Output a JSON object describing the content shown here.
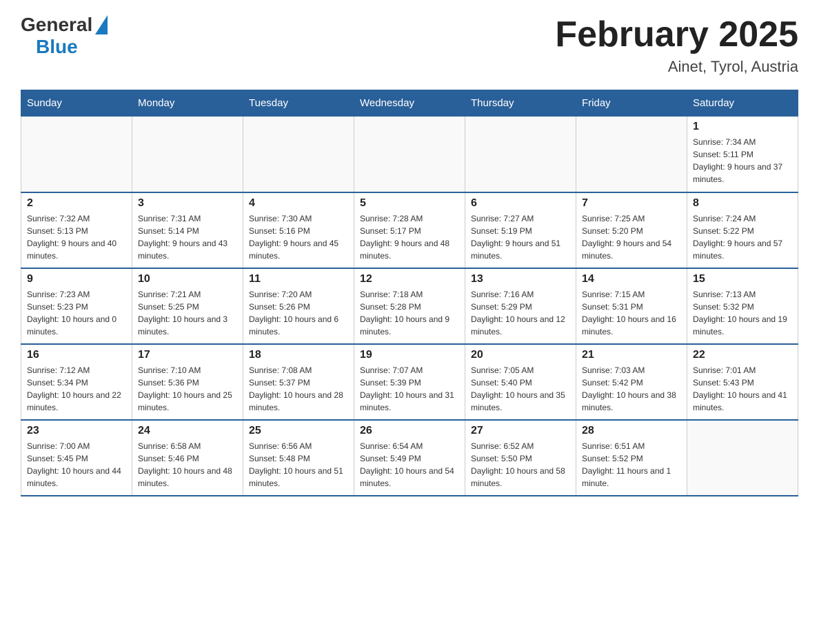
{
  "logo": {
    "general": "General",
    "blue": "Blue"
  },
  "title": "February 2025",
  "subtitle": "Ainet, Tyrol, Austria",
  "days_of_week": [
    "Sunday",
    "Monday",
    "Tuesday",
    "Wednesday",
    "Thursday",
    "Friday",
    "Saturday"
  ],
  "weeks": [
    [
      {
        "day": "",
        "info": ""
      },
      {
        "day": "",
        "info": ""
      },
      {
        "day": "",
        "info": ""
      },
      {
        "day": "",
        "info": ""
      },
      {
        "day": "",
        "info": ""
      },
      {
        "day": "",
        "info": ""
      },
      {
        "day": "1",
        "info": "Sunrise: 7:34 AM\nSunset: 5:11 PM\nDaylight: 9 hours and 37 minutes."
      }
    ],
    [
      {
        "day": "2",
        "info": "Sunrise: 7:32 AM\nSunset: 5:13 PM\nDaylight: 9 hours and 40 minutes."
      },
      {
        "day": "3",
        "info": "Sunrise: 7:31 AM\nSunset: 5:14 PM\nDaylight: 9 hours and 43 minutes."
      },
      {
        "day": "4",
        "info": "Sunrise: 7:30 AM\nSunset: 5:16 PM\nDaylight: 9 hours and 45 minutes."
      },
      {
        "day": "5",
        "info": "Sunrise: 7:28 AM\nSunset: 5:17 PM\nDaylight: 9 hours and 48 minutes."
      },
      {
        "day": "6",
        "info": "Sunrise: 7:27 AM\nSunset: 5:19 PM\nDaylight: 9 hours and 51 minutes."
      },
      {
        "day": "7",
        "info": "Sunrise: 7:25 AM\nSunset: 5:20 PM\nDaylight: 9 hours and 54 minutes."
      },
      {
        "day": "8",
        "info": "Sunrise: 7:24 AM\nSunset: 5:22 PM\nDaylight: 9 hours and 57 minutes."
      }
    ],
    [
      {
        "day": "9",
        "info": "Sunrise: 7:23 AM\nSunset: 5:23 PM\nDaylight: 10 hours and 0 minutes."
      },
      {
        "day": "10",
        "info": "Sunrise: 7:21 AM\nSunset: 5:25 PM\nDaylight: 10 hours and 3 minutes."
      },
      {
        "day": "11",
        "info": "Sunrise: 7:20 AM\nSunset: 5:26 PM\nDaylight: 10 hours and 6 minutes."
      },
      {
        "day": "12",
        "info": "Sunrise: 7:18 AM\nSunset: 5:28 PM\nDaylight: 10 hours and 9 minutes."
      },
      {
        "day": "13",
        "info": "Sunrise: 7:16 AM\nSunset: 5:29 PM\nDaylight: 10 hours and 12 minutes."
      },
      {
        "day": "14",
        "info": "Sunrise: 7:15 AM\nSunset: 5:31 PM\nDaylight: 10 hours and 16 minutes."
      },
      {
        "day": "15",
        "info": "Sunrise: 7:13 AM\nSunset: 5:32 PM\nDaylight: 10 hours and 19 minutes."
      }
    ],
    [
      {
        "day": "16",
        "info": "Sunrise: 7:12 AM\nSunset: 5:34 PM\nDaylight: 10 hours and 22 minutes."
      },
      {
        "day": "17",
        "info": "Sunrise: 7:10 AM\nSunset: 5:36 PM\nDaylight: 10 hours and 25 minutes."
      },
      {
        "day": "18",
        "info": "Sunrise: 7:08 AM\nSunset: 5:37 PM\nDaylight: 10 hours and 28 minutes."
      },
      {
        "day": "19",
        "info": "Sunrise: 7:07 AM\nSunset: 5:39 PM\nDaylight: 10 hours and 31 minutes."
      },
      {
        "day": "20",
        "info": "Sunrise: 7:05 AM\nSunset: 5:40 PM\nDaylight: 10 hours and 35 minutes."
      },
      {
        "day": "21",
        "info": "Sunrise: 7:03 AM\nSunset: 5:42 PM\nDaylight: 10 hours and 38 minutes."
      },
      {
        "day": "22",
        "info": "Sunrise: 7:01 AM\nSunset: 5:43 PM\nDaylight: 10 hours and 41 minutes."
      }
    ],
    [
      {
        "day": "23",
        "info": "Sunrise: 7:00 AM\nSunset: 5:45 PM\nDaylight: 10 hours and 44 minutes."
      },
      {
        "day": "24",
        "info": "Sunrise: 6:58 AM\nSunset: 5:46 PM\nDaylight: 10 hours and 48 minutes."
      },
      {
        "day": "25",
        "info": "Sunrise: 6:56 AM\nSunset: 5:48 PM\nDaylight: 10 hours and 51 minutes."
      },
      {
        "day": "26",
        "info": "Sunrise: 6:54 AM\nSunset: 5:49 PM\nDaylight: 10 hours and 54 minutes."
      },
      {
        "day": "27",
        "info": "Sunrise: 6:52 AM\nSunset: 5:50 PM\nDaylight: 10 hours and 58 minutes."
      },
      {
        "day": "28",
        "info": "Sunrise: 6:51 AM\nSunset: 5:52 PM\nDaylight: 11 hours and 1 minute."
      },
      {
        "day": "",
        "info": ""
      }
    ]
  ]
}
